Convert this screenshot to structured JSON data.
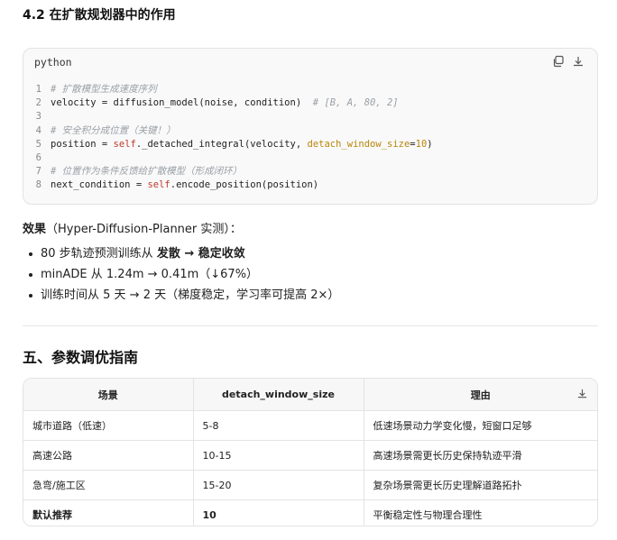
{
  "section_title": "4.2 在扩散规划器中的作用",
  "code_block": {
    "language": "python",
    "actions": [
      "copy-icon",
      "download-icon"
    ],
    "lines": [
      [
        {
          "c": "cm",
          "t": "# 扩散模型生成速度序列"
        }
      ],
      [
        {
          "c": "tx",
          "t": "velocity = diffusion_model(noise, condition)  "
        },
        {
          "c": "cm",
          "t": "# [B, A, 80, 2]"
        }
      ],
      [],
      [
        {
          "c": "cm",
          "t": "# 安全积分成位置（关键！）"
        }
      ],
      [
        {
          "c": "tx",
          "t": "position = "
        },
        {
          "c": "kw",
          "t": "self"
        },
        {
          "c": "tx",
          "t": "._detached_integral(velocity, "
        },
        {
          "c": "ar",
          "t": "detach_window_size"
        },
        {
          "c": "tx",
          "t": "="
        },
        {
          "c": "nm",
          "t": "10"
        },
        {
          "c": "tx",
          "t": ")"
        }
      ],
      [],
      [
        {
          "c": "cm",
          "t": "# 位置作为条件反馈给扩散模型（形成闭环）"
        }
      ],
      [
        {
          "c": "tx",
          "t": "next_condition = "
        },
        {
          "c": "kw",
          "t": "self"
        },
        {
          "c": "tx",
          "t": ".encode_position(position)"
        }
      ]
    ]
  },
  "effect": {
    "label": "效果",
    "rest": "（Hyper-Diffusion-Planner 实测）："
  },
  "bullets": [
    {
      "text": "80 步轨迹预测训练从 ",
      "strong": "发散 → 稳定收敛",
      "tail": ""
    },
    {
      "text": "minADE 从 1.24m → 0.41m（↓67%）",
      "strong": "",
      "tail": ""
    },
    {
      "text": "训练时间从 5 天 → 2 天（梯度稳定，学习率可提高 2×）",
      "strong": "",
      "tail": ""
    }
  ],
  "section2_title": "五、参数调优指南",
  "table": {
    "headers": [
      "场景",
      "detach_window_size",
      "理由"
    ],
    "rows": [
      {
        "cells": [
          "城市道路（低速）",
          "5-8",
          "低速场景动力学变化慢，短窗口足够"
        ],
        "bold": false
      },
      {
        "cells": [
          "高速公路",
          "10-15",
          "高速场景需更长历史保持轨迹平滑"
        ],
        "bold": false
      },
      {
        "cells": [
          "急弯/施工区",
          "15-20",
          "复杂场景需更长历史理解道路拓扑"
        ],
        "bold": false
      },
      {
        "cells": [
          "默认推荐",
          "10",
          "平衡稳定性与物理合理性"
        ],
        "bold": true
      }
    ]
  }
}
